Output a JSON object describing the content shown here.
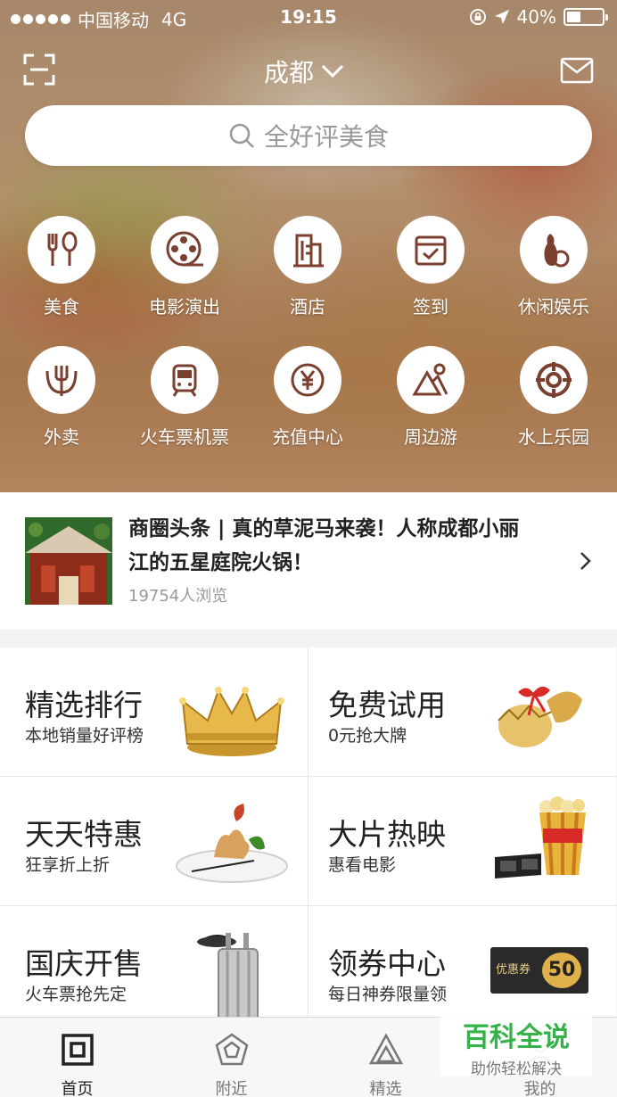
{
  "status_bar": {
    "carrier": "中国移动",
    "network": "4G",
    "time": "19:15",
    "battery": "40%",
    "battery_level": 0.4
  },
  "header": {
    "city": "成都",
    "scan_icon": "scan-icon",
    "mail_icon": "mail-icon"
  },
  "search": {
    "placeholder": "全好评美食"
  },
  "categories": [
    {
      "label": "美食",
      "icon": "cutlery-icon"
    },
    {
      "label": "电影演出",
      "icon": "film-reel-icon"
    },
    {
      "label": "酒店",
      "icon": "hotel-icon"
    },
    {
      "label": "签到",
      "icon": "checkin-icon"
    },
    {
      "label": "休闲娱乐",
      "icon": "bowling-icon"
    },
    {
      "label": "外卖",
      "icon": "fork-icon"
    },
    {
      "label": "火车票机票",
      "icon": "train-icon"
    },
    {
      "label": "充值中心",
      "icon": "yuan-coin-icon"
    },
    {
      "label": "周边游",
      "icon": "mountain-icon"
    },
    {
      "label": "水上乐园",
      "icon": "lifebuoy-icon"
    }
  ],
  "headline": {
    "title": "商圈头条 | 真的草泥马来袭！人称成都小丽江的五星庭院火锅！",
    "views": "19754人浏览"
  },
  "tiles": [
    {
      "title": "精选排行",
      "subtitle": "本地销量好评榜",
      "image": "crown-image"
    },
    {
      "title": "免费试用",
      "subtitle": "0元抢大牌",
      "image": "gift-egg-image"
    },
    {
      "title": "天天特惠",
      "subtitle": "狂享折上折",
      "image": "dessert-plate-image"
    },
    {
      "title": "大片热映",
      "subtitle": "惠看电影",
      "image": "popcorn-3d-glasses-image"
    },
    {
      "title": "国庆开售",
      "subtitle": "火车票抢先定",
      "image": "suitcase-image"
    },
    {
      "title": "领券中心",
      "subtitle": "每日神券限量领",
      "image": "coupon-image",
      "coupon_text": "优惠券",
      "coupon_value": "50"
    }
  ],
  "tabbar": [
    {
      "label": "首页",
      "icon": "home-icon",
      "active": true
    },
    {
      "label": "附近",
      "icon": "nearby-icon",
      "active": false
    },
    {
      "label": "精选",
      "icon": "featured-icon",
      "active": false
    },
    {
      "label": "我的",
      "icon": "profile-icon",
      "active": false
    }
  ],
  "watermark": {
    "title": "百科全说",
    "subtitle": "助你轻松解决"
  },
  "colors": {
    "icon_brown": "#7a3f2e",
    "watermark_green": "#35b24a"
  }
}
